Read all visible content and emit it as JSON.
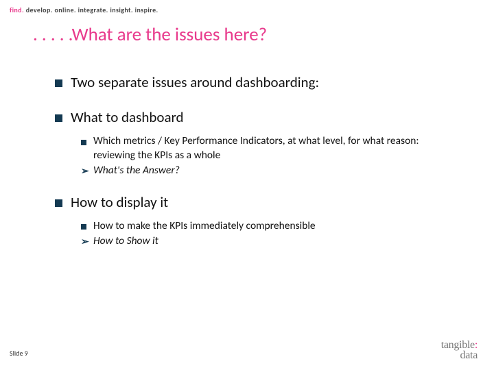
{
  "tagline": {
    "accent": "find.",
    "rest": " develop. online. integrate. insight. inspire."
  },
  "title": ". . . . .What are the issues here?",
  "items": [
    {
      "text": "Two separate issues around dashboarding:",
      "children": []
    },
    {
      "text": "What to dashboard",
      "children": [
        {
          "marker": "square",
          "text": "Which metrics / Key Performance Indicators, at what level, for what reason: reviewing the KPIs as a whole"
        },
        {
          "marker": "arrow",
          "text": "What's the Answer?",
          "italic": true
        }
      ]
    },
    {
      "text": "How to display it",
      "children": [
        {
          "marker": "square",
          "text": "How to make the KPIs  immediately comprehensible"
        },
        {
          "marker": "arrow",
          "text": "How to Show it",
          "italic": true
        }
      ]
    }
  ],
  "footer": {
    "slide_label": "Slide 9",
    "brand_top": "tangible",
    "brand_colon": ":",
    "brand_bottom": "data"
  }
}
